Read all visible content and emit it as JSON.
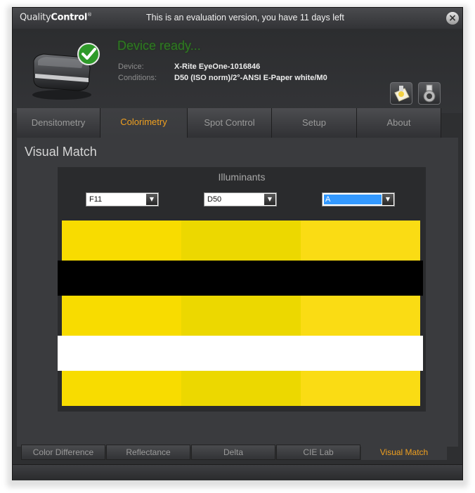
{
  "app": {
    "logo_quality": "Quality",
    "logo_control": "Control",
    "title": "This is an evaluation version, you have 11 days left",
    "close_glyph": "×"
  },
  "header": {
    "status": "Device ready...",
    "device_label": "Device:",
    "device_value": "X-Rite EyeOne-1016846",
    "conditions_label": "Conditions:",
    "conditions_value": "D50 (ISO norm)/2°-ANSI E-Paper white/M0",
    "icons": [
      "paper-light-icon",
      "lamp-icon"
    ]
  },
  "tabs": [
    {
      "label": "Densitometry",
      "active": false
    },
    {
      "label": "Colorimetry",
      "active": true
    },
    {
      "label": "Spot Control",
      "active": false
    },
    {
      "label": "Setup",
      "active": false
    },
    {
      "label": "About",
      "active": false
    }
  ],
  "main": {
    "section_title": "Visual Match",
    "panel_title": "Illuminants",
    "illuminants": [
      {
        "value": "F11",
        "focused": false
      },
      {
        "value": "D50",
        "focused": false
      },
      {
        "value": "A",
        "focused": true
      }
    ],
    "swatch_colors": [
      "#f8dc00",
      "#ecd800",
      "#fadc14"
    ],
    "band_colors": {
      "dark": "#000000",
      "light": "#ffffff"
    }
  },
  "subtabs": [
    {
      "label": "Color Difference",
      "active": false
    },
    {
      "label": "Reflectance",
      "active": false
    },
    {
      "label": "Delta",
      "active": false
    },
    {
      "label": "CIE Lab",
      "active": false
    },
    {
      "label": "Visual Match",
      "active": true
    }
  ],
  "colors": {
    "accent": "#f0a020",
    "status_green": "#2f7a22",
    "window_bg": "#2e2f31"
  }
}
